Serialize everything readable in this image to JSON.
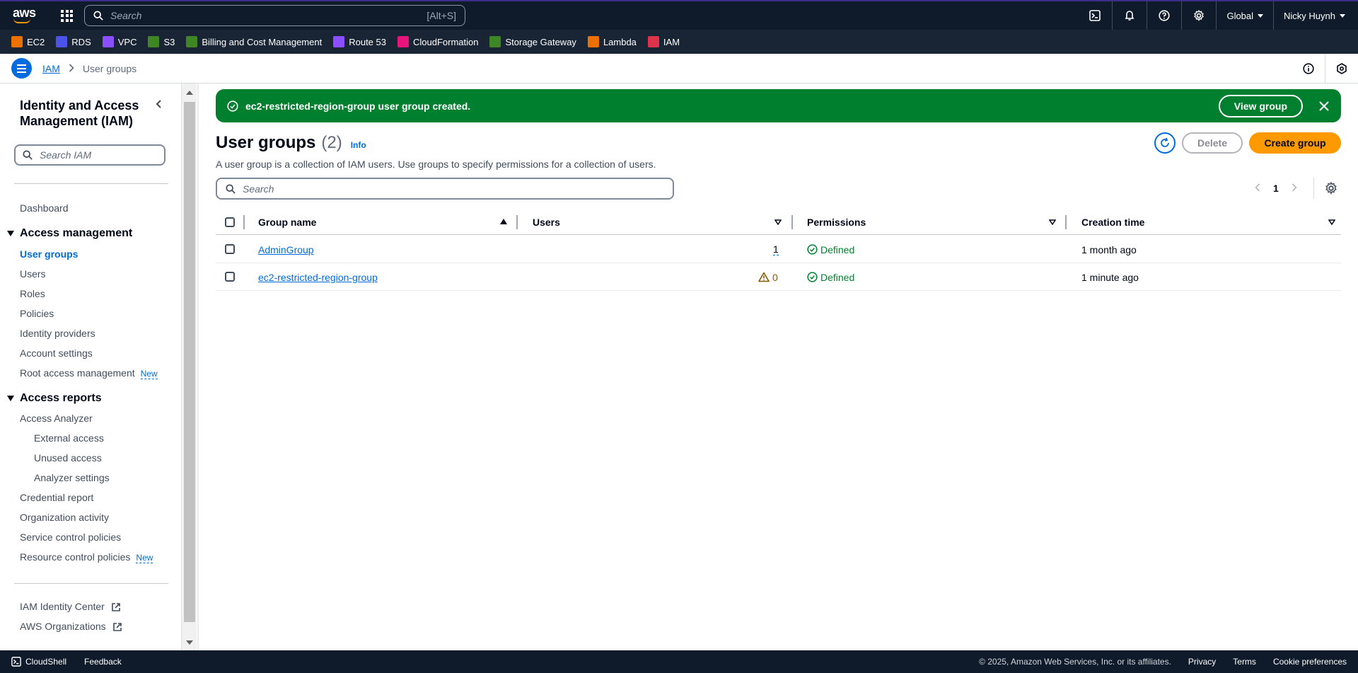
{
  "topnav": {
    "logo": "aws",
    "search_placeholder": "Search",
    "search_shortcut": "[Alt+S]",
    "region": "Global",
    "user": "Nicky Huynh",
    "icons": [
      "cloudshell-icon",
      "bell-icon",
      "help-icon",
      "gear-icon"
    ]
  },
  "favorites": [
    {
      "label": "EC2",
      "color": "#ed7100"
    },
    {
      "label": "RDS",
      "color": "#4b53e8"
    },
    {
      "label": "VPC",
      "color": "#8c4fff"
    },
    {
      "label": "S3",
      "color": "#3f8624"
    },
    {
      "label": "Billing and Cost Management",
      "color": "#3f8624"
    },
    {
      "label": "Route 53",
      "color": "#8c4fff"
    },
    {
      "label": "CloudFormation",
      "color": "#e7157b"
    },
    {
      "label": "Storage Gateway",
      "color": "#3f8624"
    },
    {
      "label": "Lambda",
      "color": "#ed7100"
    },
    {
      "label": "IAM",
      "color": "#dd344c"
    }
  ],
  "breadcrumb": {
    "root": "IAM",
    "current": "User groups"
  },
  "sidebar": {
    "title": "Identity and Access Management (IAM)",
    "search_placeholder": "Search IAM",
    "dashboard": "Dashboard",
    "access_management": {
      "label": "Access management",
      "items": [
        "User groups",
        "Users",
        "Roles",
        "Policies",
        "Identity providers",
        "Account settings",
        "Root access management"
      ],
      "new_badge": "New"
    },
    "access_reports": {
      "label": "Access reports",
      "analyzer": "Access Analyzer",
      "analyzer_items": [
        "External access",
        "Unused access",
        "Analyzer settings"
      ],
      "items": [
        "Credential report",
        "Organization activity",
        "Service control policies",
        "Resource control policies"
      ],
      "new_badge": "New"
    },
    "external": [
      "IAM Identity Center",
      "AWS Organizations"
    ]
  },
  "flash": {
    "message": "ec2-restricted-region-group user group created.",
    "button": "View group",
    "color": "#00802f"
  },
  "header": {
    "title": "User groups",
    "count": "(2)",
    "info": "Info",
    "description": "A user group is a collection of IAM users. Use groups to specify permissions for a collection of users.",
    "delete": "Delete",
    "create": "Create group"
  },
  "table": {
    "search_placeholder": "Search",
    "page": "1",
    "columns": [
      "Group name",
      "Users",
      "Permissions",
      "Creation time"
    ],
    "rows": [
      {
        "name": "AdminGroup",
        "users": "1",
        "permissions": "Defined",
        "created": "1 month ago"
      },
      {
        "name": "ec2-restricted-region-group",
        "users": "0",
        "permissions": "Defined",
        "created": "1 minute ago"
      }
    ]
  },
  "footer": {
    "cloudshell": "CloudShell",
    "feedback": "Feedback",
    "copyright": "© 2025, Amazon Web Services, Inc. or its affiliates.",
    "privacy": "Privacy",
    "terms": "Terms",
    "cookies": "Cookie preferences"
  }
}
